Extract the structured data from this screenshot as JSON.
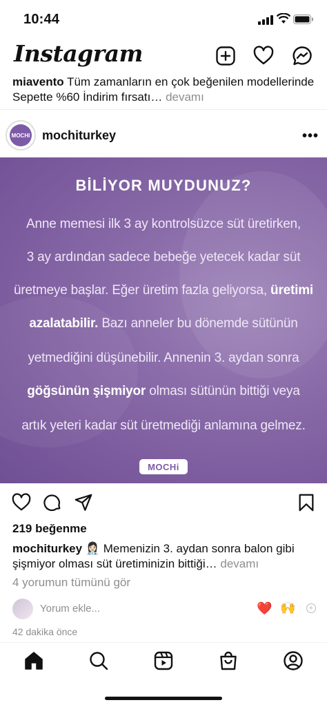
{
  "status": {
    "time": "10:44"
  },
  "app": {
    "logo": "Instagram"
  },
  "header_icons": [
    "new-post-icon",
    "heart-icon",
    "messenger-icon"
  ],
  "previous_post": {
    "username": "miavento",
    "caption": "Tüm zamanların en çok beğenilen modellerinde Sepette %60 İndirim fırsatı…",
    "more": "devamı"
  },
  "post": {
    "username": "mochiturkey",
    "avatar_text": "MOCHI",
    "image": {
      "title": "BİLİYOR MUYDUNUZ?",
      "line1": "Anne memesi ilk 3 ay kontrolsüzce süt üretirken,",
      "line2": "3 ay ardından sadece bebeğe yetecek kadar süt",
      "line3a": "üretmeye başlar. Eğer üretim fazla geliyorsa,",
      "line3b": "üretimi",
      "line4a": "azalatabilir.",
      "line4b": "Bazı anneler bu dönemde sütünün",
      "line5": "yetmediğini düşünebilir. Annenin 3. aydan sonra",
      "line6a": "göğsünün şişmiyor",
      "line6b": "olması sütünün bittiği veya",
      "line7": "artık yeteri kadar süt üretmediği anlamına gelmez.",
      "badge": "MOCHi"
    },
    "likes": "219 beğenme",
    "caption_user": "mochiturkey",
    "caption_text": "Memenizin 3. aydan sonra balon gibi şişmiyor olması süt üretiminizin bittiği…",
    "caption_more": "devamı",
    "view_comments": "4 yorumun tümünü gör",
    "comment_placeholder": "Yorum ekle...",
    "quick_emoji_1": "❤️",
    "quick_emoji_2": "🙌",
    "time_ago": "42 dakika önce"
  },
  "tabbar": [
    "home-icon",
    "search-icon",
    "reels-icon",
    "shop-icon",
    "profile-icon"
  ]
}
